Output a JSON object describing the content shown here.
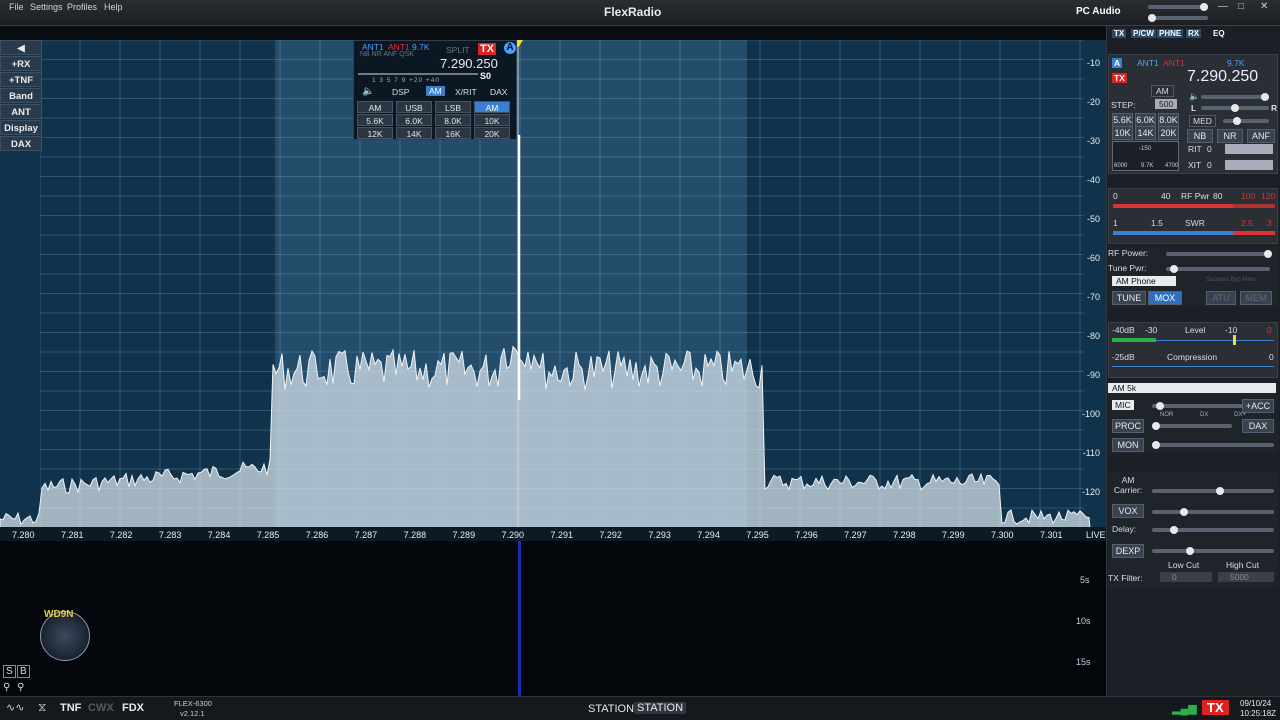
{
  "menu": {
    "file": "File",
    "settings": "Settings",
    "profiles": "Profiles",
    "help": "Help"
  },
  "brand": {
    "logo": "FlexRadio",
    "pc_audio": "PC Audio"
  },
  "left_buttons": [
    "+RX",
    "+TNF",
    "Band",
    "ANT",
    "Display",
    "DAX"
  ],
  "dbm_labels": [
    "-10",
    "-20",
    "-30",
    "-40",
    "-50",
    "-60",
    "-70",
    "-80",
    "-90",
    "-100",
    "-110",
    "-120"
  ],
  "freq_labels": [
    "7.280",
    "7.281",
    "7.282",
    "7.283",
    "7.284",
    "7.285",
    "7.286",
    "7.287",
    "7.288",
    "7.289",
    "7.290",
    "7.291",
    "7.292",
    "7.293",
    "7.294",
    "7.295",
    "7.296",
    "7.297",
    "7.298",
    "7.299",
    "7.300",
    "7.301"
  ],
  "live": "LIVE",
  "wf_labels": [
    "5s",
    "10s",
    "15s"
  ],
  "callsign": "WD9N",
  "rx_flag": {
    "ant1": "ANT1",
    "ant1b": "ANT1",
    "bw": "9.7K",
    "split": "SPLIT",
    "tx": "TX",
    "slice": "A",
    "nb": "NB NR ANF QSK",
    "freq": "7.290.250",
    "smeter": "S0",
    "scale": "1 3 5 7 9 +20 +40",
    "tabs": [
      "DSP",
      "AM",
      "X/RIT",
      "DAX"
    ],
    "modes": [
      "AM",
      "USB",
      "LSB",
      "AM"
    ],
    "filters": [
      "5.6K",
      "6.0K",
      "8.0K",
      "10K",
      "12K",
      "14K",
      "16K",
      "20K"
    ]
  },
  "right_tabs": [
    "TX",
    "P/CW",
    "PHNE",
    "RX",
    "EQ"
  ],
  "rp": {
    "ant1": "ANT1",
    "ant1b": "ANT1",
    "bw": "9.7K",
    "freq": "7.290.250",
    "mode": "AM",
    "step": "STEP:",
    "step_val": "500",
    "filters": [
      "5.6K",
      "6.0K",
      "8.0K",
      "10K",
      "14K",
      "20K"
    ],
    "lr_l": "L",
    "lr_r": "R",
    "agc": "MED",
    "nb": "NB",
    "nr": "NR",
    "anf": "ANF",
    "rit": "RIT",
    "rit_v": "0",
    "xit": "XIT",
    "xit_v": "0",
    "filt_low": "6000",
    "filt_mid": "9.7K",
    "filt_high": "4700",
    "filt_top": "-150"
  },
  "meters": {
    "rfpwr_scale": [
      "0",
      "40",
      "RF Pwr",
      "80",
      "100",
      "120"
    ],
    "swr_scale": [
      "1",
      "1.5",
      "SWR",
      "2.5",
      "3"
    ]
  },
  "tx": {
    "rf_power": "RF Power:",
    "tune_pwr": "Tune Pwr:",
    "profile": "AM Phone",
    "tune": "TUNE",
    "mox": "MOX",
    "atu": "ATU",
    "mem": "MEM",
    "atu_status": "Success Byp Mem"
  },
  "level": {
    "scale": [
      "-40dB",
      "-30",
      "Level",
      "-10",
      "0"
    ],
    "comp_scale": [
      "-25dB",
      "Compression",
      "0"
    ]
  },
  "phne": {
    "profile": "AM 5k",
    "mic": "MIC",
    "acc": "+ACC",
    "proc": "PROC",
    "dax": "DAX",
    "mon": "MON",
    "proc_scale": [
      "NOR",
      "DX",
      "DX+"
    ]
  },
  "vox": {
    "am_carrier": "AM Carrier:",
    "vox": "VOX",
    "delay": "Delay:",
    "dexp": "DEXP",
    "low_cut": "Low Cut",
    "high_cut": "High Cut",
    "tx_filter": "TX Filter:",
    "low_val": "0",
    "high_val": "5000"
  },
  "status": {
    "tnf": "TNF",
    "cwx": "CWX",
    "fdx": "FDX",
    "model": "FLEX-6300",
    "version": "v2.12.1",
    "station_lbl": "STATION:",
    "station": "STATION",
    "tx": "TX",
    "date": "09/10/24",
    "time": "10:25:18Z"
  },
  "colors": {
    "accent": "#2f6fc0",
    "tx_red": "#d22",
    "meter_red": "#d33",
    "meter_blue": "#3a7fd0"
  }
}
